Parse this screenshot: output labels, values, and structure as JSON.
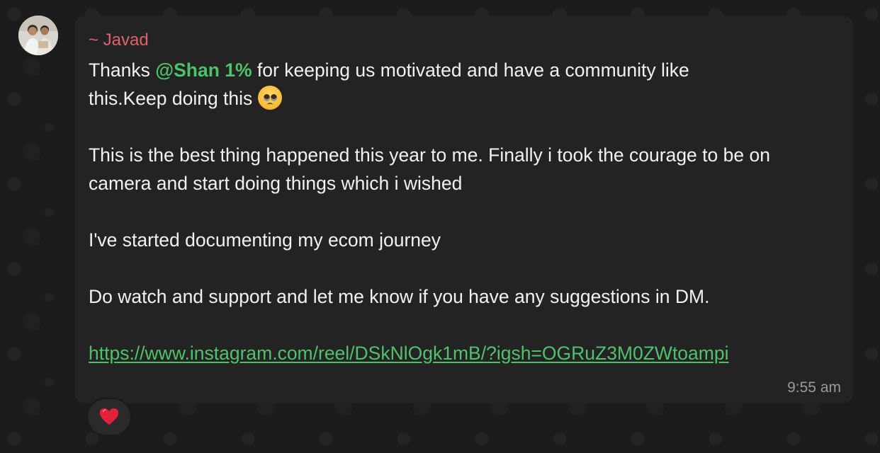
{
  "sender": {
    "name": "~ Javad"
  },
  "message": {
    "line1_before": "Thanks ",
    "mention": "@Shan 1%",
    "line1_after": " for keeping us motivated and have a community like",
    "line2": "this.Keep doing this",
    "emoji": "pleading-face-emoji",
    "para2": "This is the best thing happened this year to me. Finally i took the courage to be on camera and start doing things which i wished",
    "para3": "I've started documenting my ecom journey",
    "para4": "Do watch and support and let me know if you have any suggestions in DM.",
    "link": "https://www.instagram.com/reel/DSkNlOgk1mB/?igsh=OGRuZ3M0ZWtoampi"
  },
  "timestamp": "9:55 am",
  "reaction": {
    "icon": "red-heart-icon"
  },
  "colors": {
    "sender": "#e0606b",
    "accent": "#4fc16a",
    "bubble": "#232323",
    "background": "#1c1c1c"
  }
}
